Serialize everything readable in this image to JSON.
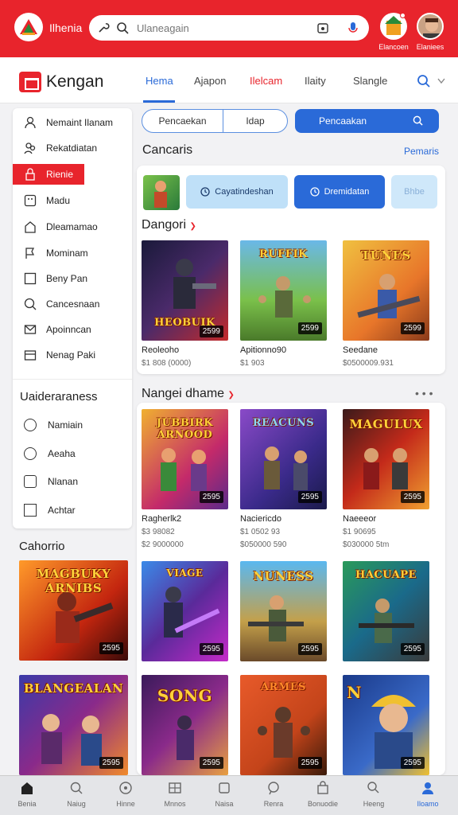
{
  "topbar": {
    "app_title": "Ilhenia",
    "search_placeholder": "Ulaneagain",
    "user1_label": "Elancoen",
    "user2_label": "Elaniees"
  },
  "header": {
    "brand": "Kengan",
    "tabs": [
      "Hema",
      "Ajapon",
      "Ilelcam",
      "Ilaity",
      "Slangle"
    ]
  },
  "sidebar": {
    "items": [
      "Nemaint Ilanam",
      "Rekatdiatan",
      "Rienie",
      "Madu",
      "Dleamamao",
      "Mominam",
      "Beny Pan",
      "Cancesnaan",
      "Apoinncan",
      "Nenag Paki"
    ],
    "heading": "Uaideraraness",
    "sub_items": [
      "Namiain",
      "Aeaha",
      "Nlanan",
      "Achtar"
    ]
  },
  "left_section_title": "Cahorrio",
  "main": {
    "seg_left": "Pencaekan",
    "seg_right": "Idap",
    "blue_search": "Pencaakan",
    "categories_title": "Cancaris",
    "categories_link": "Pemaris",
    "chip1": "Cayatindeshan",
    "chip2": "Dremidatan",
    "chip3": "Bhbe",
    "dangori_title": "Dangori",
    "row1": [
      {
        "logo": "HEOBUIK",
        "price": "2599",
        "title": "Reoleoho",
        "sub": "$1 808 (0000)"
      },
      {
        "logo": "RUFFIK",
        "price": "2599",
        "title": "Apitionno90",
        "sub": "$1 903"
      },
      {
        "logo": "TUNES",
        "price": "2599",
        "title": "Seedane",
        "sub": "$0500009.931"
      }
    ],
    "nangei_title": "Nangei dhame",
    "row2": [
      {
        "logo": "JUBBIRK ARNOOD",
        "price": "2595",
        "title": "Ragherlk2",
        "sub1": "$3 98082",
        "sub2": "$2 9000000"
      },
      {
        "logo": "REACUNS",
        "price": "2595",
        "title": "Naciericdo",
        "sub1": "$1 0502 93",
        "sub2": "$050000 590"
      },
      {
        "logo": "MAGULUX",
        "price": "2595",
        "title": "Naeeeor",
        "sub1": "$1 90695",
        "sub2": "$030000 5tm"
      }
    ],
    "row3": [
      {
        "logo": "VIAGE",
        "price": "2595"
      },
      {
        "logo": "NUNESS",
        "price": "2595"
      },
      {
        "logo": "HACUAPE",
        "price": "2595"
      }
    ],
    "row4": [
      {
        "logo": "SONG",
        "price": "2595"
      },
      {
        "logo": "ARMES",
        "price": "2595"
      },
      {
        "logo": "N",
        "price": "2595"
      }
    ]
  },
  "left_tiles": [
    {
      "logo": "MAGBUKY ARNIBS",
      "price": "2595"
    },
    {
      "logo": "BLANGEALAN",
      "price": "2595"
    }
  ],
  "bottom_nav": [
    "Benia",
    "Naiug",
    "Hinne",
    "Mnnos",
    "Naisa",
    "Renra",
    "Bonuodie",
    "Heeng",
    "Iloamo"
  ]
}
